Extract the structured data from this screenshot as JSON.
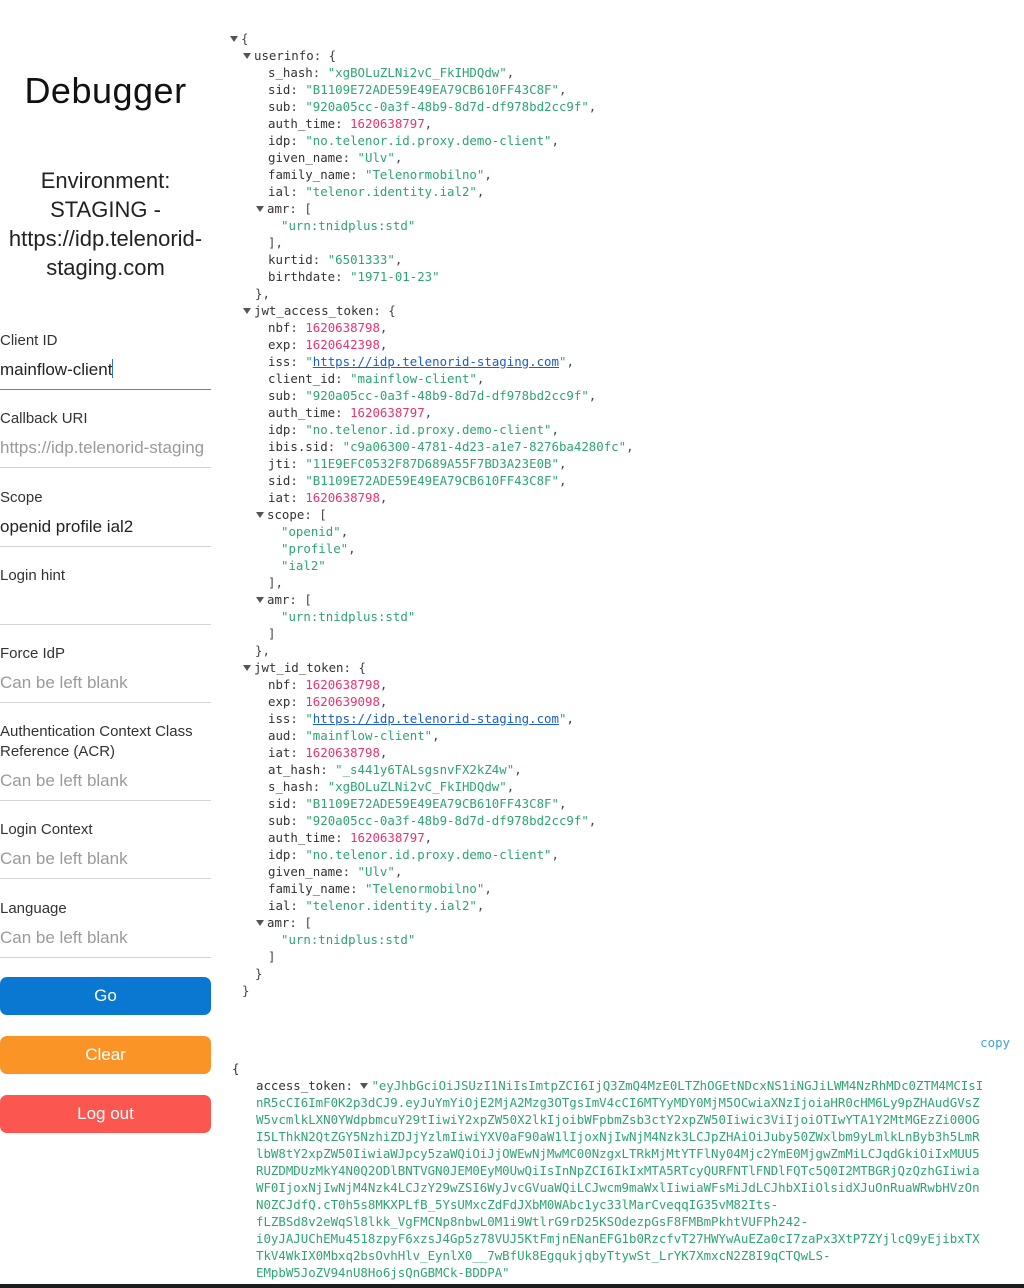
{
  "sidebar": {
    "title": "Debugger",
    "environment_lines": [
      "Environment:",
      "STAGING -",
      "https://idp.telenorid-",
      "staging.com"
    ],
    "fields": [
      {
        "label": "Client ID",
        "value": "mainflow-client",
        "placeholder": "",
        "focused": true
      },
      {
        "label": "Callback URI",
        "value": "",
        "placeholder": "https://idp.telenorid-staging"
      },
      {
        "label": "Scope",
        "value": "openid profile ial2",
        "placeholder": ""
      },
      {
        "label": "Login hint",
        "value": "",
        "placeholder": ""
      },
      {
        "label": "Force IdP",
        "value": "",
        "placeholder": "Can be left blank"
      },
      {
        "label_lines": [
          "Authentication Context Class",
          "Reference (ACR)"
        ],
        "value": "",
        "placeholder": "Can be left blank"
      },
      {
        "label": "Login Context",
        "value": "",
        "placeholder": "Can be left blank"
      },
      {
        "label": "Language",
        "value": "",
        "placeholder": "Can be left blank"
      }
    ],
    "buttons": {
      "go": "Go",
      "clear": "Clear",
      "logout": "Log out"
    },
    "colors": {
      "go": "#0a78d0",
      "clear": "#fb9427",
      "logout": "#fb5650"
    }
  },
  "json_view": {
    "lines": [
      {
        "i": 0,
        "t": 1,
        "p": "{"
      },
      {
        "i": 1,
        "t": 1,
        "k": "userinfo",
        "p": "{"
      },
      {
        "i": 2,
        "k": "s_hash",
        "s": "xgBOLuZLNi2vC_FkIHDQdw",
        "c": ","
      },
      {
        "i": 2,
        "k": "sid",
        "s": "B1109E72ADE59E49EA79CB610FF43C8F",
        "c": ","
      },
      {
        "i": 2,
        "k": "sub",
        "s": "920a05cc-0a3f-48b9-8d7d-df978bd2cc9f",
        "c": ","
      },
      {
        "i": 2,
        "k": "auth_time",
        "n": "1620638797",
        "c": ","
      },
      {
        "i": 2,
        "k": "idp",
        "s": "no.telenor.id.proxy.demo-client",
        "c": ","
      },
      {
        "i": 2,
        "k": "given_name",
        "s": "Ulv",
        "c": ","
      },
      {
        "i": 2,
        "k": "family_name",
        "s": "Telenormobilno",
        "c": ","
      },
      {
        "i": 2,
        "k": "ial",
        "s": "telenor.identity.ial2",
        "c": ","
      },
      {
        "i": 2,
        "t": 1,
        "k": "amr",
        "p": "["
      },
      {
        "i": 3,
        "s": "urn:tnidplus:std"
      },
      {
        "i": 2,
        "p": "],"
      },
      {
        "i": 2,
        "k": "kurtid",
        "s": "6501333",
        "c": ","
      },
      {
        "i": 2,
        "k": "birthdate",
        "s": "1971-01-23"
      },
      {
        "i": 1,
        "p": "},"
      },
      {
        "i": 1,
        "t": 1,
        "k": "jwt_access_token",
        "p": "{"
      },
      {
        "i": 2,
        "k": "nbf",
        "n": "1620638798",
        "c": ","
      },
      {
        "i": 2,
        "k": "exp",
        "n": "1620642398",
        "c": ","
      },
      {
        "i": 2,
        "k": "iss",
        "u": "https://idp.telenorid-staging.com",
        "c": ","
      },
      {
        "i": 2,
        "k": "client_id",
        "s": "mainflow-client",
        "c": ","
      },
      {
        "i": 2,
        "k": "sub",
        "s": "920a05cc-0a3f-48b9-8d7d-df978bd2cc9f",
        "c": ","
      },
      {
        "i": 2,
        "k": "auth_time",
        "n": "1620638797",
        "c": ","
      },
      {
        "i": 2,
        "k": "idp",
        "s": "no.telenor.id.proxy.demo-client",
        "c": ","
      },
      {
        "i": 2,
        "k": "ibis.sid",
        "s": "c9a06300-4781-4d23-a1e7-8276ba4280fc",
        "c": ","
      },
      {
        "i": 2,
        "k": "jti",
        "s": "11E9EFC0532F87D689A55F7BD3A23E0B",
        "c": ","
      },
      {
        "i": 2,
        "k": "sid",
        "s": "B1109E72ADE59E49EA79CB610FF43C8F",
        "c": ","
      },
      {
        "i": 2,
        "k": "iat",
        "n": "1620638798",
        "c": ","
      },
      {
        "i": 2,
        "t": 1,
        "k": "scope",
        "p": "["
      },
      {
        "i": 3,
        "s": "openid",
        "c": ","
      },
      {
        "i": 3,
        "s": "profile",
        "c": ","
      },
      {
        "i": 3,
        "s": "ial2"
      },
      {
        "i": 2,
        "p": "],"
      },
      {
        "i": 2,
        "t": 1,
        "k": "amr",
        "p": "["
      },
      {
        "i": 3,
        "s": "urn:tnidplus:std"
      },
      {
        "i": 2,
        "p": "]"
      },
      {
        "i": 1,
        "p": "},"
      },
      {
        "i": 1,
        "t": 1,
        "k": "jwt_id_token",
        "p": "{"
      },
      {
        "i": 2,
        "k": "nbf",
        "n": "1620638798",
        "c": ","
      },
      {
        "i": 2,
        "k": "exp",
        "n": "1620639098",
        "c": ","
      },
      {
        "i": 2,
        "k": "iss",
        "u": "https://idp.telenorid-staging.com",
        "c": ","
      },
      {
        "i": 2,
        "k": "aud",
        "s": "mainflow-client",
        "c": ","
      },
      {
        "i": 2,
        "k": "iat",
        "n": "1620638798",
        "c": ","
      },
      {
        "i": 2,
        "k": "at_hash",
        "s": "_s441y6TALsgsnvFX2kZ4w",
        "c": ","
      },
      {
        "i": 2,
        "k": "s_hash",
        "s": "xgBOLuZLNi2vC_FkIHDQdw",
        "c": ","
      },
      {
        "i": 2,
        "k": "sid",
        "s": "B1109E72ADE59E49EA79CB610FF43C8F",
        "c": ","
      },
      {
        "i": 2,
        "k": "sub",
        "s": "920a05cc-0a3f-48b9-8d7d-df978bd2cc9f",
        "c": ","
      },
      {
        "i": 2,
        "k": "auth_time",
        "n": "1620638797",
        "c": ","
      },
      {
        "i": 2,
        "k": "idp",
        "s": "no.telenor.id.proxy.demo-client",
        "c": ","
      },
      {
        "i": 2,
        "k": "given_name",
        "s": "Ulv",
        "c": ","
      },
      {
        "i": 2,
        "k": "family_name",
        "s": "Telenormobilno",
        "c": ","
      },
      {
        "i": 2,
        "k": "ial",
        "s": "telenor.identity.ial2",
        "c": ","
      },
      {
        "i": 2,
        "t": 1,
        "k": "amr",
        "p": "["
      },
      {
        "i": 3,
        "s": "urn:tnidplus:std"
      },
      {
        "i": 2,
        "p": "]"
      },
      {
        "i": 1,
        "p": "}"
      },
      {
        "i": 0,
        "p": "}"
      }
    ]
  },
  "token_view": {
    "copy_label": "copy",
    "open_brace": "{",
    "key": "access_token",
    "lines": [
      "\"eyJhbGciOiJSUzI1NiIsImtpZCI6IjQ3ZmQ4MzE0LTZhOGEtNDcxNS1iNGJiLWM4NzRhMDc0ZTM4MCIsI",
      "nR5cCI6ImF0K2p3dCJ9.eyJuYmYiOjE2MjA2Mzg3OTgsImV4cCI6MTYyMDY0MjM5OCwiaXNzIjoiaHR0cHM6Ly9pZHAudGVsZ",
      "W5vcmlkLXN0YWdpbmcuY29tIiwiY2xpZW50X2lkIjoibWFpbmZsb3ctY2xpZW50Iiwic3ViIjoiOTIwYTA1Y2MtMGEzZi00OG",
      "I5LThkN2QtZGY5NzhiZDJjYzlmIiwiYXV0aF90aW1lIjoxNjIwNjM4Nzk3LCJpZHAiOiJuby50ZWxlbm9yLmlkLnByb3h5LmR",
      "lbW8tY2xpZW50IiwiaWJpcy5zaWQiOiJjOWEwNjMwMC00NzgxLTRkMjMtYTFlNy04Mjc2YmE0MjgwZmMiLCJqdGkiOiIxMUU5",
      "RUZDMDUzMkY4N0Q2ODlBNTVGN0JEM0EyM0UwQiIsInNpZCI6IkIxMTA5RTcyQURFNTlFNDlFQTc5Q0I2MTBGRjQzQzhGIiwia",
      "WF0IjoxNjIwNjM4Nzk4LCJzY29wZSI6WyJvcGVuaWQiLCJwcm9maWxlIiwiaWFsMiJdLCJhbXIiOlsidXJuOnRuaWRwbHVzOn",
      "N0ZCJdfQ.cT0h5s8MKXPLfB_5YsUMxcZdFdJXbM0WAbc1yc33lMarCveqqIG35vM82Its-",
      "fLZBSd8v2eWqSl8lkk_VgFMCNp8nbwL0M1i9WtlrG9rD25KSOdezpGsF8FMBmPkhtVUFPh242-",
      "i0yJAJUChEMu4518zpyF6xzsJ4Gp5z78VUJ5KtFmjnENanEFG1b0RzcfvT27HWYwAuEZa0cI7zaPx3XtP7ZYjlcQ9yEjibxTX",
      "TkV4WkIX0Mbxq2bsOvhHlv_EynlX0__7wBfUk8EgqukjqbyTtywSt_LrYK7XmxcN2Z8I9qCTQwLS-",
      "EMpbW5JoZV94nU8Ho6jsQnGBMCk-BDDPA\""
    ]
  }
}
